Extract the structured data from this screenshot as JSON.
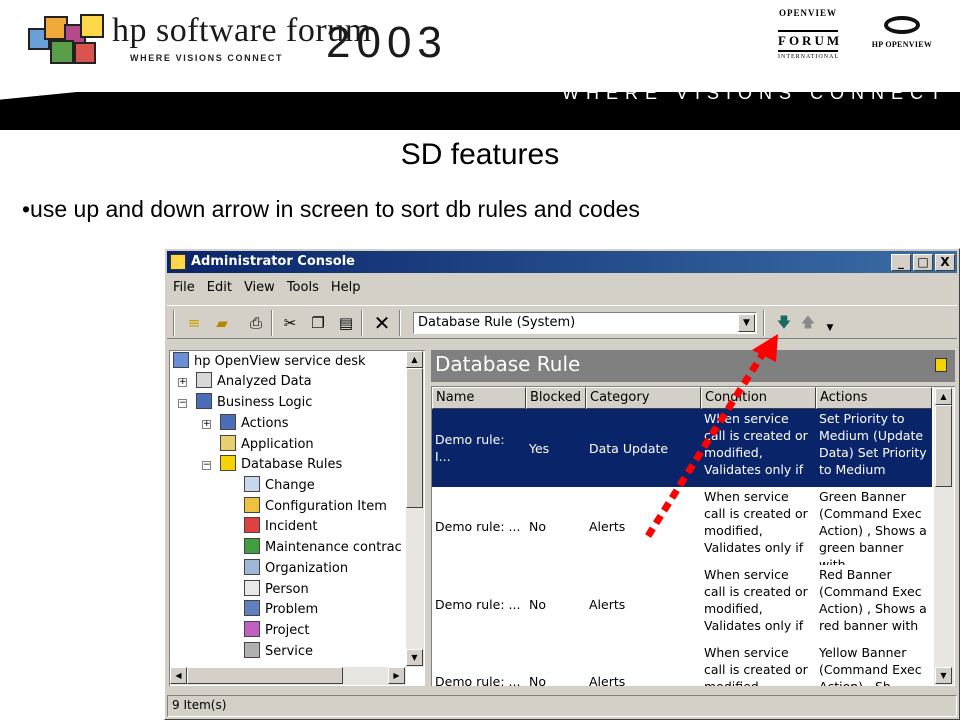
{
  "header": {
    "brand": "hp software forum",
    "tagline": "WHERE VISIONS CONNECT",
    "year": "2003",
    "band_text": "WHERE VISIONS CONNECT",
    "openview_forum_top": "OPENVIEW",
    "openview_forum_main": "FORUM",
    "openview_forum_sub": "INTERNATIONAL",
    "hp_openview_logo": "HP OPENVIEW"
  },
  "slide": {
    "title": "SD features",
    "bullet": "•use up and down arrow in screen to sort db rules and codes"
  },
  "window": {
    "title": "Administrator Console",
    "min_btn": "_",
    "max_btn": "□",
    "close_btn": "X",
    "menu": [
      "File",
      "Edit",
      "View",
      "Tools",
      "Help"
    ],
    "combo_value": "Database Rule (System)",
    "status": "9 Item(s)"
  },
  "tree": {
    "items": [
      {
        "label": "hp OpenView service desk",
        "icon": "service-desk-icon"
      },
      {
        "label": "Analyzed Data",
        "icon": "analyzed-data-icon"
      },
      {
        "label": "Business Logic",
        "icon": "business-logic-icon"
      },
      {
        "label": "Actions",
        "icon": "actions-icon"
      },
      {
        "label": "Application",
        "icon": "application-icon"
      },
      {
        "label": "Database Rules",
        "icon": "database-icon"
      },
      {
        "label": "Change",
        "icon": "change-icon"
      },
      {
        "label": "Configuration Item",
        "icon": "configuration-item-icon"
      },
      {
        "label": "Incident",
        "icon": "incident-icon"
      },
      {
        "label": "Maintenance contrac",
        "icon": "maintenance-contract-icon"
      },
      {
        "label": "Organization",
        "icon": "organization-icon"
      },
      {
        "label": "Person",
        "icon": "person-icon"
      },
      {
        "label": "Problem",
        "icon": "problem-icon"
      },
      {
        "label": "Project",
        "icon": "project-icon"
      },
      {
        "label": "Service",
        "icon": "service-icon"
      }
    ]
  },
  "panel": {
    "title": "Database Rule",
    "columns": [
      "Name",
      "Blocked",
      "Category",
      "Condition",
      "Actions"
    ],
    "rows": [
      {
        "name": "Demo rule: I...",
        "blocked": "Yes",
        "category": "Data Update",
        "condition": "When service call is created or modified, Validates only if",
        "actions": "Set Priority to Medium (Update Data) Set Priority to Medium"
      },
      {
        "name": "Demo rule: ...",
        "blocked": "No",
        "category": "Alerts",
        "condition": "When service call is created or modified, Validates only if",
        "actions": "Green Banner (Command Exec Action) , Shows a green banner with"
      },
      {
        "name": "Demo rule: ...",
        "blocked": "No",
        "category": "Alerts",
        "condition": "When service call is created or modified, Validates only if",
        "actions": "Red Banner (Command Exec Action) , Shows a red banner with"
      },
      {
        "name": "Demo rule: ...",
        "blocked": "No",
        "category": "Alerts",
        "condition": "When service call is created or modified",
        "actions": "Yellow Banner (Command Exec Action) , Sh"
      }
    ]
  },
  "colors": {
    "title_bar": "#0a246a",
    "selection": "#0a246a",
    "panel_header": "#808080",
    "annotation_arrow": "#ff0000"
  }
}
